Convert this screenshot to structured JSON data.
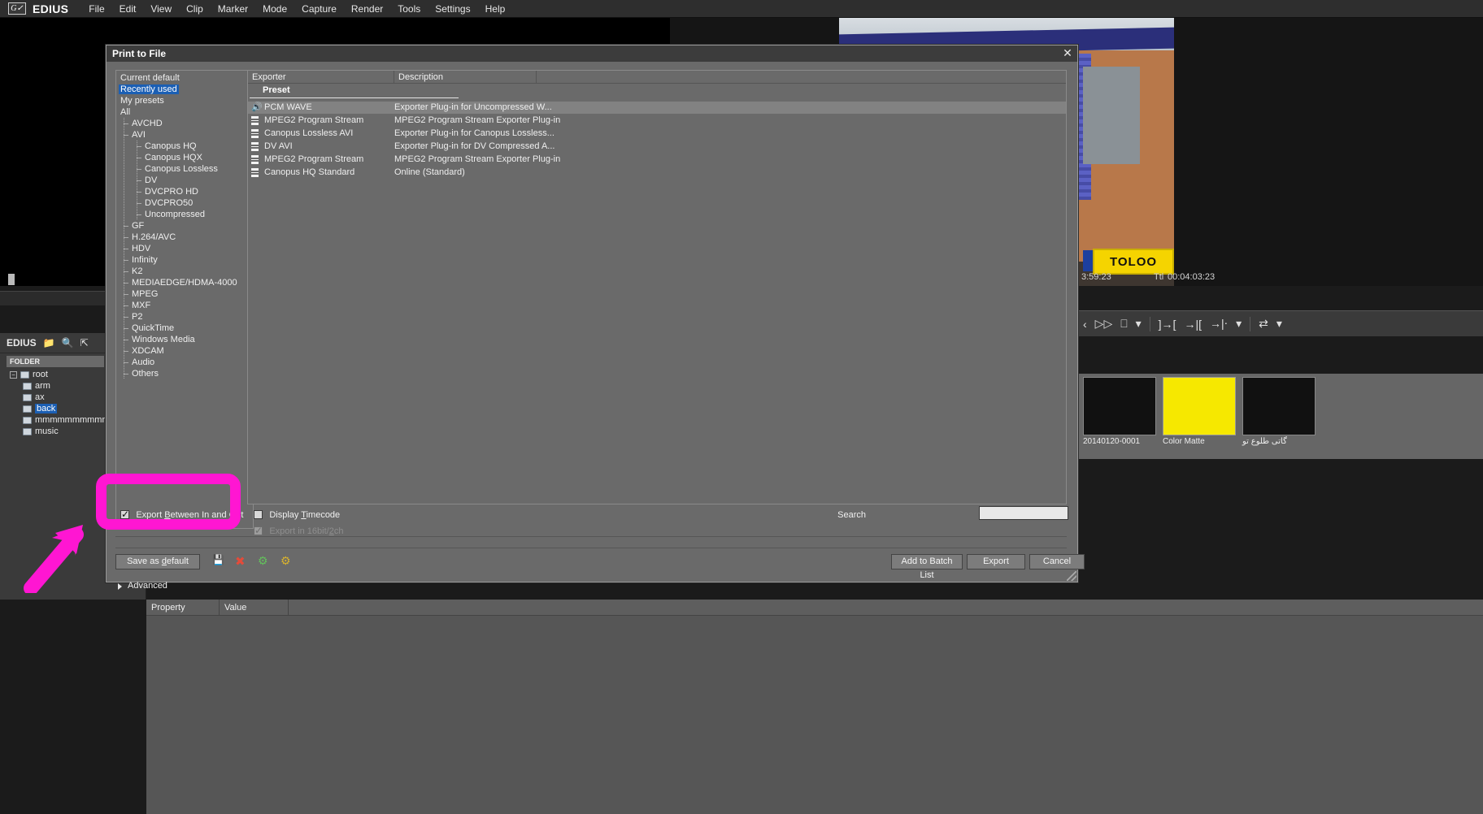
{
  "app": {
    "name": "EDIUS",
    "logo_icon": "edius-logo-icon",
    "menus": [
      "File",
      "Edit",
      "View",
      "Clip",
      "Marker",
      "Mode",
      "Capture",
      "Render",
      "Tools",
      "Settings",
      "Help"
    ]
  },
  "player": {
    "timecode_left": "3:59:23",
    "timecode_label": "Ttl",
    "timecode_total": "00:04:03:23",
    "sign_text": "TOLOO",
    "transport_icons": [
      "play-forward-icon",
      "monitor-icon",
      "dropdown-caret-icon",
      "mark-in-icon",
      "mark-out-icon",
      "set-in-out-icon",
      "caret-icon",
      "loop-icon",
      "caret2-icon"
    ]
  },
  "bin": {
    "title": "EDIUS",
    "toolbar_icons": [
      "folder-icon",
      "search-icon",
      "up-folder-icon"
    ],
    "folder_header": "FOLDER",
    "tree": [
      {
        "label": "root",
        "level": 0,
        "expander": "-",
        "selected": false
      },
      {
        "label": "arm",
        "level": 1,
        "expander": "",
        "selected": false
      },
      {
        "label": "ax",
        "level": 1,
        "expander": "",
        "selected": false
      },
      {
        "label": "back",
        "level": 1,
        "expander": "",
        "selected": true
      },
      {
        "label": "mmmmmmmmmmm",
        "level": 1,
        "expander": "",
        "selected": false
      },
      {
        "label": "music",
        "level": 1,
        "expander": "",
        "selected": false
      }
    ],
    "thumbnails": [
      {
        "label": "20140120-0001",
        "type": "video-thumbnail"
      },
      {
        "label": "Color Matte",
        "type": "color-matte-thumbnail"
      },
      {
        "label": "گاتی طلوع تو",
        "type": "title-thumbnail"
      }
    ]
  },
  "properties": {
    "columns": [
      "Property",
      "Value"
    ]
  },
  "dialog": {
    "title": "Print to File",
    "close_icon": "close-icon",
    "categories": [
      {
        "label": "Current default",
        "level": 0,
        "selected": false
      },
      {
        "label": "Recently used",
        "level": 0,
        "selected": true
      },
      {
        "label": "My presets",
        "level": 0,
        "selected": false
      },
      {
        "label": "All",
        "level": 0,
        "selected": false
      },
      {
        "label": "AVCHD",
        "level": 1,
        "selected": false
      },
      {
        "label": "AVI",
        "level": 1,
        "selected": false
      },
      {
        "label": "Canopus HQ",
        "level": 2,
        "selected": false
      },
      {
        "label": "Canopus HQX",
        "level": 2,
        "selected": false
      },
      {
        "label": "Canopus Lossless",
        "level": 2,
        "selected": false
      },
      {
        "label": "DV",
        "level": 2,
        "selected": false
      },
      {
        "label": "DVCPRO HD",
        "level": 2,
        "selected": false
      },
      {
        "label": "DVCPRO50",
        "level": 2,
        "selected": false
      },
      {
        "label": "Uncompressed",
        "level": 2,
        "selected": false
      },
      {
        "label": "GF",
        "level": 1,
        "selected": false
      },
      {
        "label": "H.264/AVC",
        "level": 1,
        "selected": false
      },
      {
        "label": "HDV",
        "level": 1,
        "selected": false
      },
      {
        "label": "Infinity",
        "level": 1,
        "selected": false
      },
      {
        "label": "K2",
        "level": 1,
        "selected": false
      },
      {
        "label": "MEDIAEDGE/HDMA-4000",
        "level": 1,
        "selected": false
      },
      {
        "label": "MPEG",
        "level": 1,
        "selected": false
      },
      {
        "label": "MXF",
        "level": 1,
        "selected": false
      },
      {
        "label": "P2",
        "level": 1,
        "selected": false
      },
      {
        "label": "QuickTime",
        "level": 1,
        "selected": false
      },
      {
        "label": "Windows Media",
        "level": 1,
        "selected": false
      },
      {
        "label": "XDCAM",
        "level": 1,
        "selected": false
      },
      {
        "label": "Audio",
        "level": 1,
        "selected": false
      },
      {
        "label": "Others",
        "level": 1,
        "selected": false
      }
    ],
    "columns": {
      "exporter": "Exporter",
      "description": "Description"
    },
    "group_label": "Preset",
    "presets": [
      {
        "name": "PCM WAVE",
        "description": "Exporter Plug-in for Uncompressed W...",
        "icon": "audio-icon",
        "selected": true
      },
      {
        "name": "MPEG2 Program Stream",
        "description": "MPEG2 Program Stream Exporter Plug-in",
        "icon": "film-icon",
        "selected": false
      },
      {
        "name": "Canopus Lossless AVI",
        "description": "Exporter Plug-in for Canopus Lossless...",
        "icon": "film-icon",
        "selected": false
      },
      {
        "name": "DV AVI",
        "description": "Exporter Plug-in for DV Compressed A...",
        "icon": "film-icon",
        "selected": false
      },
      {
        "name": "MPEG2 Program Stream",
        "description": "MPEG2 Program Stream Exporter Plug-in",
        "icon": "film-icon",
        "selected": false
      },
      {
        "name": "Canopus HQ Standard",
        "description": "Online (Standard)",
        "icon": "film-icon",
        "selected": false
      }
    ],
    "options": {
      "export_between": {
        "label": "Export Between In and Out",
        "checked": true,
        "enabled": true
      },
      "display_timecode": {
        "label": "Display Timecode",
        "checked": false,
        "enabled": true
      },
      "export_16bit": {
        "label": "Export in 16bit/2ch",
        "checked": true,
        "enabled": false
      }
    },
    "search": {
      "label": "Search",
      "value": "",
      "placeholder": ""
    },
    "advanced": {
      "label": "Advanced",
      "expander_icon": "triangle-right-icon"
    },
    "buttons": {
      "save_as_default": "Save as default",
      "add_to_batch": "Add to Batch List",
      "export": "Export",
      "cancel": "Cancel"
    },
    "tool_icons": [
      "save-preset-icon",
      "delete-preset-icon",
      "new-preset-icon",
      "edit-preset-icon"
    ],
    "resize_grip_icon": "resize-grip-icon"
  },
  "annotations": {
    "highlight_color": "#ff16d2",
    "shapes": [
      "rounded-rect-highlight",
      "arrow-pointer"
    ]
  }
}
